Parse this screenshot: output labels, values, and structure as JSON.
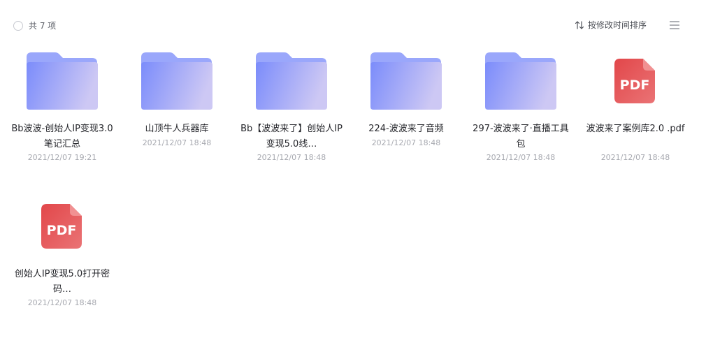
{
  "toolbar": {
    "item_count": "共 7 项",
    "sort_label": "按修改时间排序",
    "sort_icon": "sort-arrows-icon",
    "menu_icon": "hamburger-menu-icon"
  },
  "colors": {
    "folder_back": "#9aa7fb",
    "folder_front_start": "#7b8cfb",
    "folder_front_end": "#cdc8f4",
    "pdf_start": "#e2474a",
    "pdf_end": "#ea7375"
  },
  "items": [
    {
      "type": "folder",
      "name": "Bb波波-创始人IP变现3.0笔记汇总",
      "date": "2021/12/07 19:21",
      "lines": 2
    },
    {
      "type": "folder",
      "name": "山顶牛人兵器库",
      "date": "2021/12/07 18:48",
      "lines": 1
    },
    {
      "type": "folder",
      "name": "Bb【波波来了】创始人IP变现5.0线…",
      "date": "2021/12/07 18:48",
      "lines": 2
    },
    {
      "type": "folder",
      "name": "224-波波来了音频",
      "date": "2021/12/07 18:48",
      "lines": 1
    },
    {
      "type": "folder",
      "name": "297-波波来了·直播工具包",
      "date": "2021/12/07 18:48",
      "lines": 2
    },
    {
      "type": "pdf",
      "name": "波波来了案例库2.0 .pdf",
      "date": "2021/12/07 18:48",
      "lines": 2,
      "badge": "PDF"
    },
    {
      "type": "pdf",
      "name": "创始人IP变现5.0打开密码…",
      "date": "2021/12/07 18:48",
      "lines": 2,
      "badge": "PDF"
    }
  ]
}
